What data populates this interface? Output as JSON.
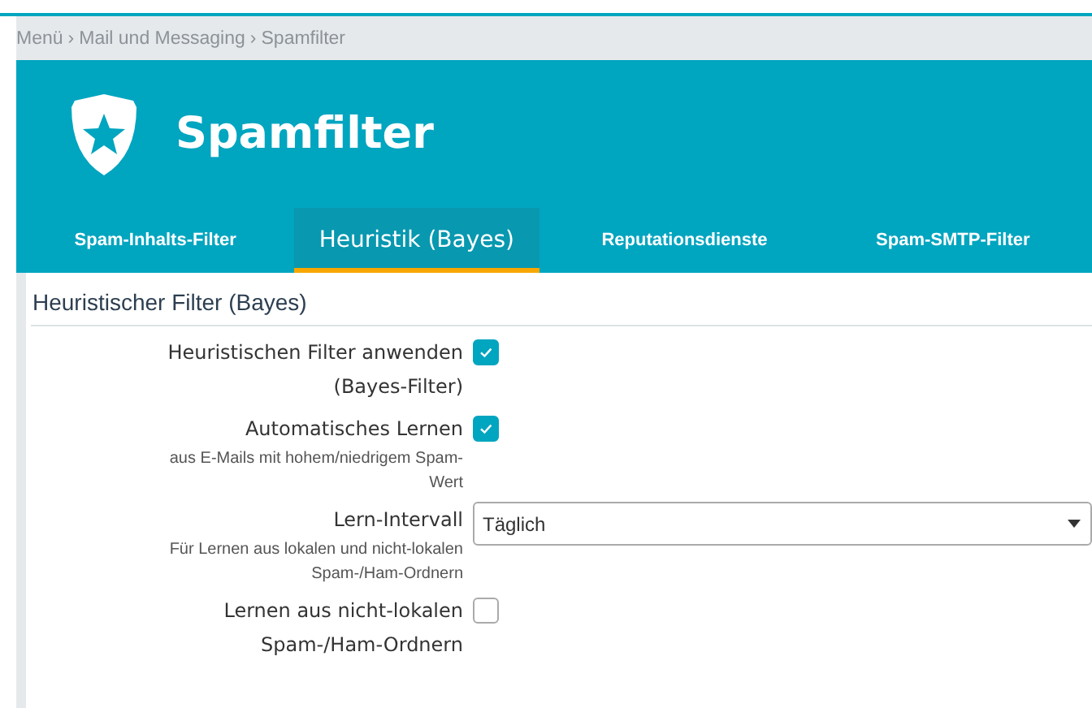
{
  "breadcrumb": [
    "Menü",
    "Mail und Messaging",
    "Spamfilter"
  ],
  "breadcrumb_separator": "›",
  "header": {
    "title": "Spamfilter"
  },
  "tabs": [
    {
      "label": "Spam-Inhalts-Filter",
      "selected": false
    },
    {
      "label": "Heuristik (Bayes)",
      "selected": true
    },
    {
      "label": "Reputationsdienste",
      "selected": false
    },
    {
      "label": "Spam-SMTP-Filter",
      "selected": false
    }
  ],
  "section": {
    "title": "Heuristischer Filter (Bayes)"
  },
  "fields": [
    {
      "kind": "checkbox",
      "label": "Heuristischen Filter anwenden (Bayes-Filter)",
      "checked": true
    },
    {
      "kind": "checkbox",
      "label": "Automatisches Lernen",
      "hint": "aus E-Mails mit hohem/niedrigem Spam-Wert",
      "checked": true
    },
    {
      "kind": "select",
      "label": "Lern-Intervall",
      "hint": "Für Lernen aus lokalen und nicht-lokalen Spam-/Ham-Ordnern",
      "value": "Täglich"
    },
    {
      "kind": "checkbox",
      "label": "Lernen aus nicht-lokalen Spam-/Ham-Ordnern",
      "checked": false
    }
  ]
}
